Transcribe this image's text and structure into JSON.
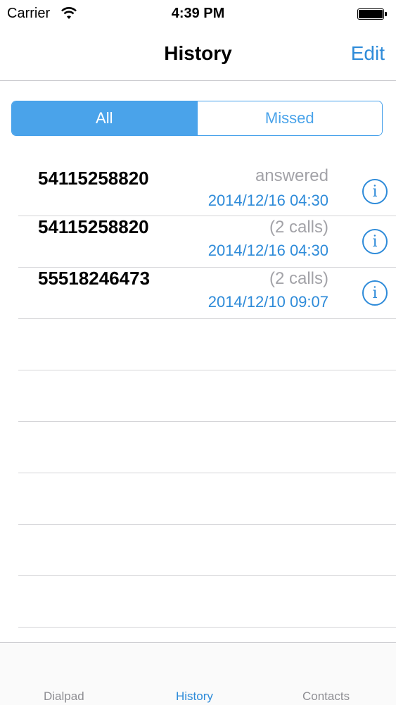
{
  "statusbar": {
    "carrier": "Carrier",
    "time": "4:39 PM"
  },
  "navbar": {
    "title": "History",
    "edit": "Edit"
  },
  "segment": {
    "all": "All",
    "missed": "Missed"
  },
  "calls": [
    {
      "number": "54115258820",
      "status": "answered",
      "date": "2014/12/16 04:30"
    },
    {
      "number": "54115258820",
      "status": "(2 calls)",
      "date": "2014/12/16 04:30"
    },
    {
      "number": "55518246473",
      "status": "(2 calls)",
      "date": "2014/12/10 09:07"
    }
  ],
  "tabs": {
    "dialpad": "Dialpad",
    "history": "History",
    "contacts": "Contacts"
  },
  "colors": {
    "accent": "#2e8bd9",
    "segment_active": "#4aa3ea",
    "muted": "#a3a3a8"
  }
}
